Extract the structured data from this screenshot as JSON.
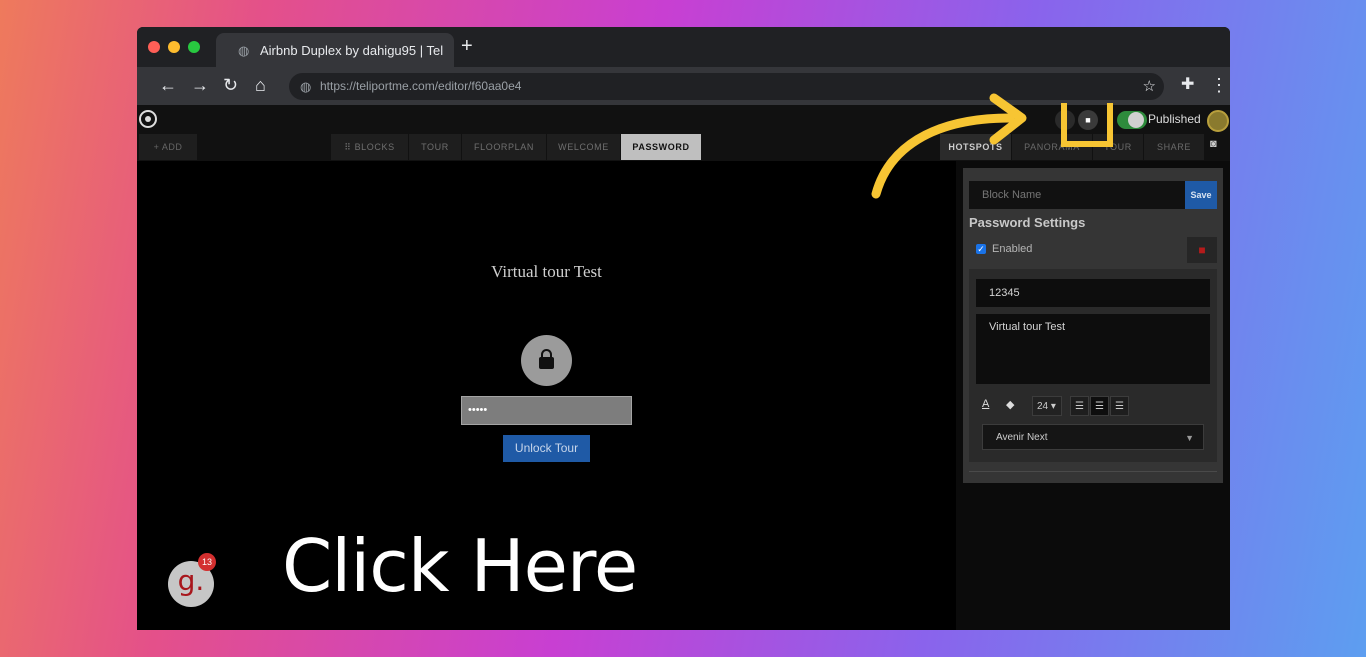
{
  "browser": {
    "tab_title": "Airbnb Duplex by dahigu95 | Tel",
    "url": "https://teliportme.com/editor/f60aa0e4",
    "new_tab_symbol": "+"
  },
  "colors": {
    "accent_blue": "#1f5aa6",
    "highlight_yellow": "#f7c533",
    "toggle_green": "#2e8b3c"
  },
  "editor": {
    "add_label": "+ ADD",
    "nav_tabs": [
      {
        "label": "⠿ BLOCKS"
      },
      {
        "label": "TOUR"
      },
      {
        "label": "FLOORPLAN"
      },
      {
        "label": "WELCOME"
      },
      {
        "label": "PASSWORD"
      }
    ],
    "right_tabs": [
      {
        "label": "HOTSPOTS"
      },
      {
        "label": "PANORAMA"
      },
      {
        "label": "TOUR"
      },
      {
        "label": "SHARE"
      }
    ],
    "publish_label": "Published"
  },
  "preview": {
    "title": "Virtual tour Test",
    "password_mask": "•••••",
    "unlock_label": "Unlock Tour"
  },
  "panel": {
    "block_name_placeholder": "Block Name",
    "save_label": "Save",
    "heading": "Password Settings",
    "enabled_label": "Enabled",
    "password_value": "12345",
    "message_value": "Virtual tour Test",
    "font_size": "24",
    "font_family": "Avenir Next"
  },
  "overlay": {
    "guide_letter": "g.",
    "guide_badge": "13",
    "cta": "Click Here"
  }
}
